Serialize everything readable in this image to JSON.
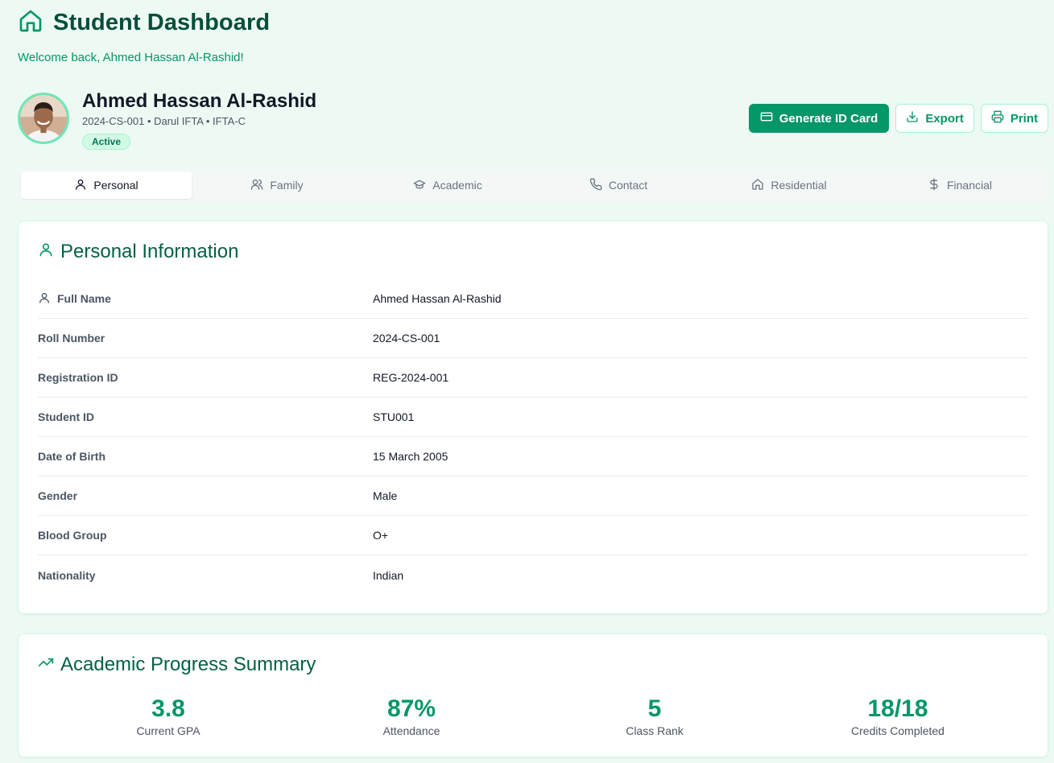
{
  "header": {
    "title": "Student Dashboard",
    "welcome": "Welcome back, Ahmed Hassan Al-Rashid!"
  },
  "student": {
    "name": "Ahmed Hassan Al-Rashid",
    "meta": "2024-CS-001 • Darul IFTA • IFTA-C",
    "status": "Active"
  },
  "actions": {
    "generate_id": "Generate ID Card",
    "export": "Export",
    "print": "Print"
  },
  "tabs": [
    {
      "label": "Personal",
      "icon": "user-icon",
      "active": true
    },
    {
      "label": "Family",
      "icon": "users-icon",
      "active": false
    },
    {
      "label": "Academic",
      "icon": "graduation-cap-icon",
      "active": false
    },
    {
      "label": "Contact",
      "icon": "phone-icon",
      "active": false
    },
    {
      "label": "Residential",
      "icon": "home-icon",
      "active": false
    },
    {
      "label": "Financial",
      "icon": "dollar-icon",
      "active": false
    }
  ],
  "personal": {
    "title": "Personal Information",
    "fields": [
      {
        "label": "Full Name",
        "value": "Ahmed Hassan Al-Rashid"
      },
      {
        "label": "Roll Number",
        "value": "2024-CS-001"
      },
      {
        "label": "Registration ID",
        "value": "REG-2024-001"
      },
      {
        "label": "Student ID",
        "value": "STU001"
      },
      {
        "label": "Date of Birth",
        "value": "15 March 2005"
      },
      {
        "label": "Gender",
        "value": "Male"
      },
      {
        "label": "Blood Group",
        "value": "O+"
      },
      {
        "label": "Nationality",
        "value": "Indian"
      }
    ]
  },
  "progress": {
    "title": "Academic Progress Summary",
    "stats": [
      {
        "value": "3.8",
        "label": "Current GPA"
      },
      {
        "value": "87%",
        "label": "Attendance"
      },
      {
        "value": "5",
        "label": "Class Rank"
      },
      {
        "value": "18/18",
        "label": "Credits Completed"
      }
    ]
  },
  "colors": {
    "accent": "#059669",
    "title": "#064e3b",
    "background": "#edfaf3",
    "badge_bg": "#d1fae5"
  }
}
